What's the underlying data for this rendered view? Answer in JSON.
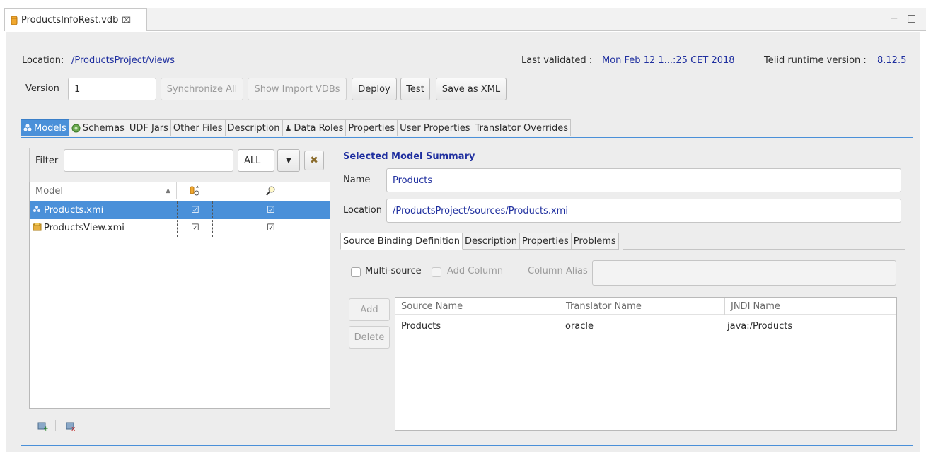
{
  "editor_tab": {
    "title": "ProductsInfoRest.vdb",
    "close": "⌧",
    "minimize": "−",
    "maximize": "□"
  },
  "header": {
    "location_label": "Location:",
    "location_value": "/ProductsProject/views",
    "last_validated_label": "Last validated :",
    "last_validated_value": "Mon Feb 12 1...:25 CET 2018",
    "runtime_label": "Teiid runtime version :",
    "runtime_value": "8.12.5"
  },
  "toolbar": {
    "version_label": "Version",
    "version_value": "1",
    "sync_all": "Synchronize All",
    "show_import": "Show Import VDBs",
    "deploy": "Deploy",
    "test": "Test",
    "save_xml": "Save as XML"
  },
  "main_tabs": [
    {
      "label": "Models",
      "active": true
    },
    {
      "label": "Schemas"
    },
    {
      "label": "UDF Jars"
    },
    {
      "label": "Other Files"
    },
    {
      "label": "Description"
    },
    {
      "label": "Data Roles"
    },
    {
      "label": "Properties"
    },
    {
      "label": "User Properties"
    },
    {
      "label": "Translator Overrides"
    }
  ],
  "models": {
    "filter_label": "Filter",
    "filter_value": "",
    "filter_scope": "ALL",
    "columns": [
      "Model",
      "",
      ""
    ],
    "rows": [
      {
        "name": "Products.xmi",
        "visible": "☑",
        "include": "☑",
        "selected": true
      },
      {
        "name": "ProductsView.xmi",
        "visible": "☑",
        "include": "☑",
        "selected": false
      }
    ]
  },
  "summary": {
    "heading": "Selected Model Summary",
    "name_label": "Name",
    "name_value": "Products",
    "location_label": "Location",
    "location_value": "/ProductsProject/sources/Products.xmi"
  },
  "sub_tabs": [
    {
      "label": "Source Binding Definition",
      "active": true
    },
    {
      "label": "Description"
    },
    {
      "label": "Properties"
    },
    {
      "label": "Problems"
    }
  ],
  "binding": {
    "multi_source_label": "Multi-source",
    "add_column_label": "Add Column",
    "column_alias_label": "Column Alias",
    "column_alias_value": "",
    "add_button": "Add",
    "delete_button": "Delete",
    "columns": [
      "Source Name",
      "Translator Name",
      "JNDI Name"
    ],
    "rows": [
      {
        "source": "Products",
        "translator": "oracle",
        "jndi": "java:/Products"
      }
    ]
  },
  "colors": {
    "accent": "#4a90d9",
    "link": "#1f2f9f"
  }
}
